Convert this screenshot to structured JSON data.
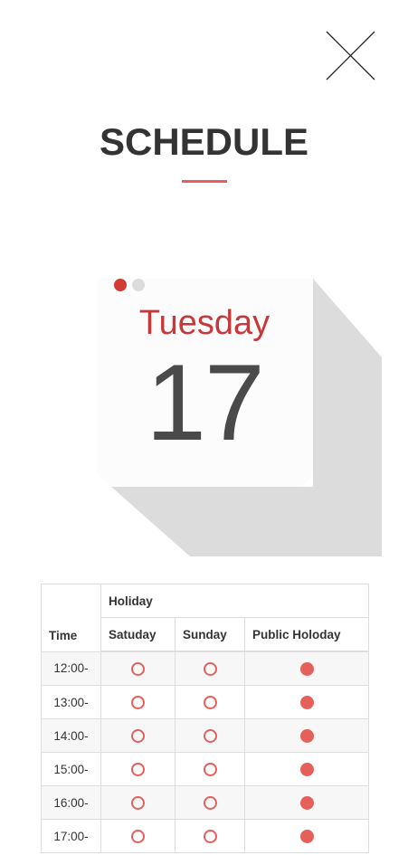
{
  "page": {
    "title": "SCHEDULE",
    "accent_color": "#e5605a"
  },
  "close_button": {
    "icon": "close-icon"
  },
  "calendar": {
    "icon": "calendar-icon",
    "day": "Tuesday",
    "date": "17"
  },
  "table": {
    "headers": {
      "time": "Time",
      "group": "Holiday",
      "columns": [
        "Satuday",
        "Sunday",
        "Public Holoday"
      ]
    },
    "rows": [
      {
        "time": "12:00-",
        "saturday": "open",
        "sunday": "open",
        "public_holiday": "filled"
      },
      {
        "time": "13:00-",
        "saturday": "open",
        "sunday": "open",
        "public_holiday": "filled"
      },
      {
        "time": "14:00-",
        "saturday": "open",
        "sunday": "open",
        "public_holiday": "filled"
      },
      {
        "time": "15:00-",
        "saturday": "open",
        "sunday": "open",
        "public_holiday": "filled"
      },
      {
        "time": "16:00-",
        "saturday": "open",
        "sunday": "open",
        "public_holiday": "filled"
      },
      {
        "time": "17:00-",
        "saturday": "open",
        "sunday": "open",
        "public_holiday": "filled"
      }
    ]
  }
}
